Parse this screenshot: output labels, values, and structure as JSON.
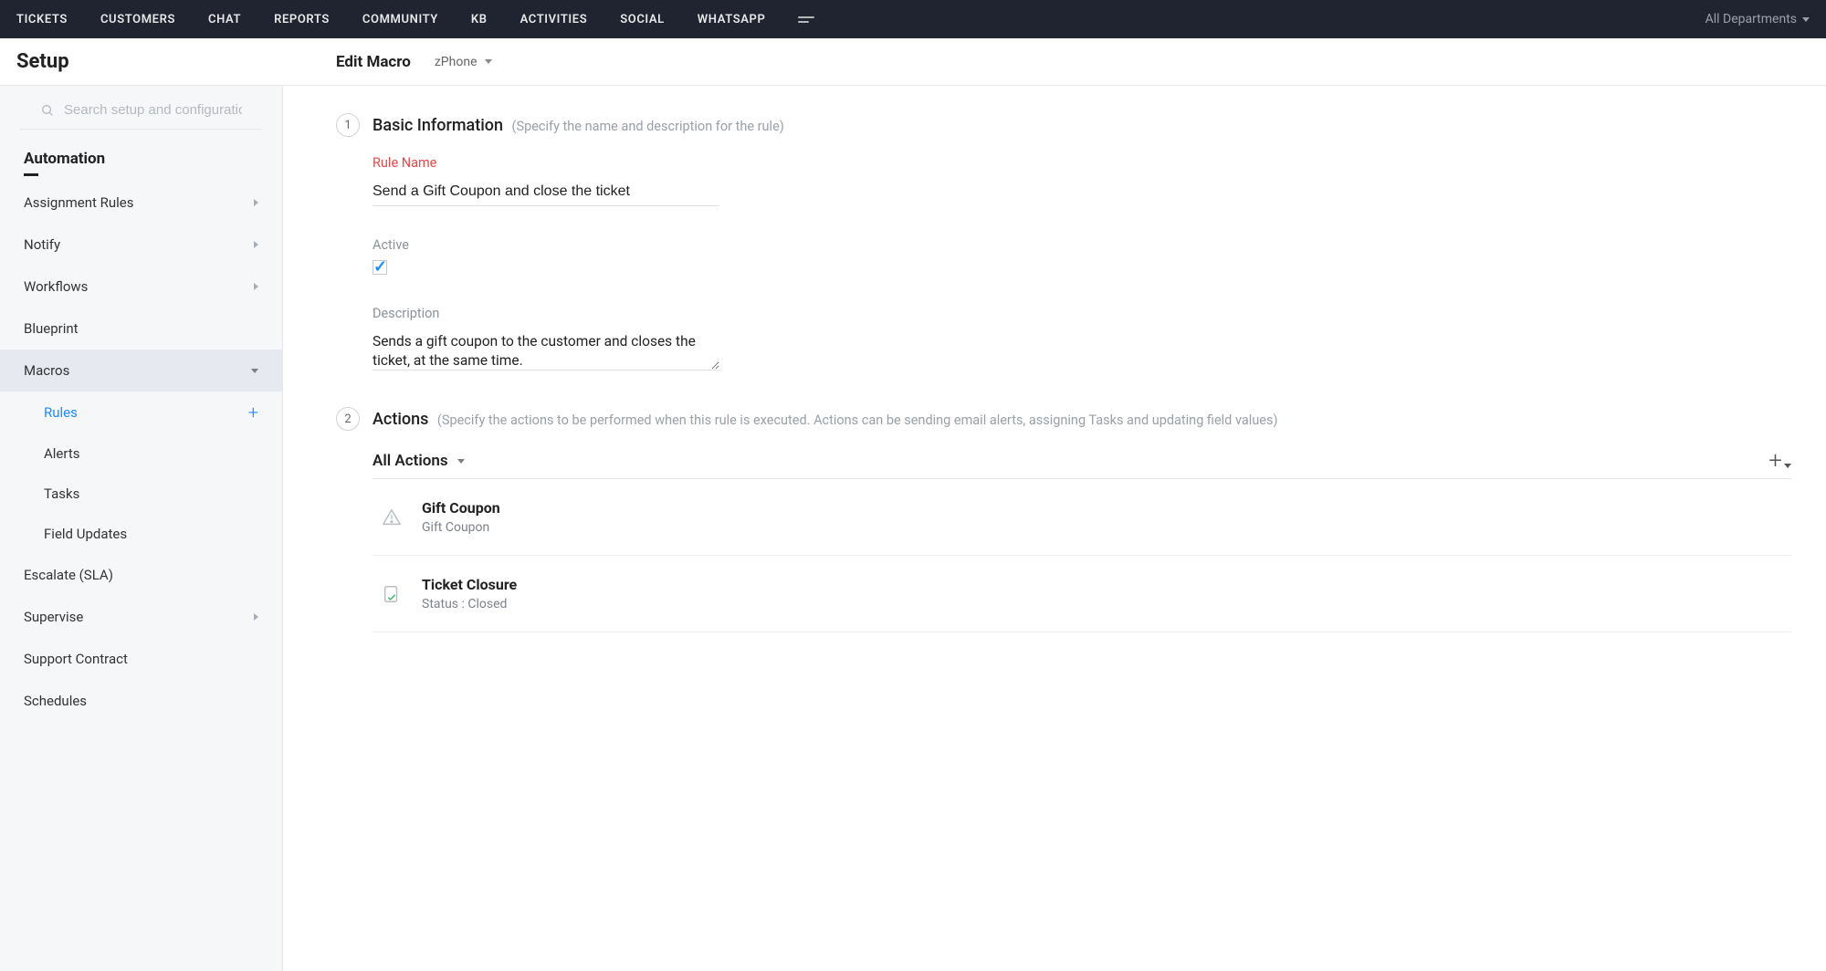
{
  "topnav": {
    "items": [
      "TICKETS",
      "CUSTOMERS",
      "CHAT",
      "REPORTS",
      "COMMUNITY",
      "KB",
      "ACTIVITIES",
      "SOCIAL",
      "WHATSAPP"
    ],
    "right_label": "All Departments"
  },
  "header": {
    "setup_title": "Setup",
    "page_title": "Edit Macro",
    "department": "zPhone"
  },
  "sidebar": {
    "search_placeholder": "Search setup and configuration...",
    "group_title": "Automation",
    "items": [
      {
        "label": "Assignment Rules",
        "has_chevron": true
      },
      {
        "label": "Notify",
        "has_chevron": true
      },
      {
        "label": "Workflows",
        "has_chevron": true
      },
      {
        "label": "Blueprint"
      },
      {
        "label": "Macros",
        "expanded": true,
        "active": true,
        "children": [
          {
            "label": "Rules",
            "selected": true,
            "has_add": true
          },
          {
            "label": "Alerts"
          },
          {
            "label": "Tasks"
          },
          {
            "label": "Field Updates"
          }
        ]
      },
      {
        "label": "Escalate (SLA)"
      },
      {
        "label": "Supervise",
        "has_chevron": true
      },
      {
        "label": "Support Contract"
      },
      {
        "label": "Schedules"
      }
    ]
  },
  "section1": {
    "step": "1",
    "title": "Basic Information",
    "hint": "(Specify the name and description for the rule)",
    "rule_name_label": "Rule Name",
    "rule_name_value": "Send a Gift Coupon and close the ticket",
    "active_label": "Active",
    "active_checked": true,
    "description_label": "Description",
    "description_value": "Sends a gift coupon to the customer and closes the ticket, at the same time."
  },
  "section2": {
    "step": "2",
    "title": "Actions",
    "hint": "(Specify the actions to be performed when this rule is executed. Actions can be sending email alerts, assigning Tasks and updating field values)",
    "dropdown_label": "All Actions",
    "items": [
      {
        "icon": "alert",
        "title": "Gift Coupon",
        "sub": "Gift Coupon"
      },
      {
        "icon": "field",
        "title": "Ticket Closure",
        "sub": "Status : Closed"
      }
    ]
  }
}
